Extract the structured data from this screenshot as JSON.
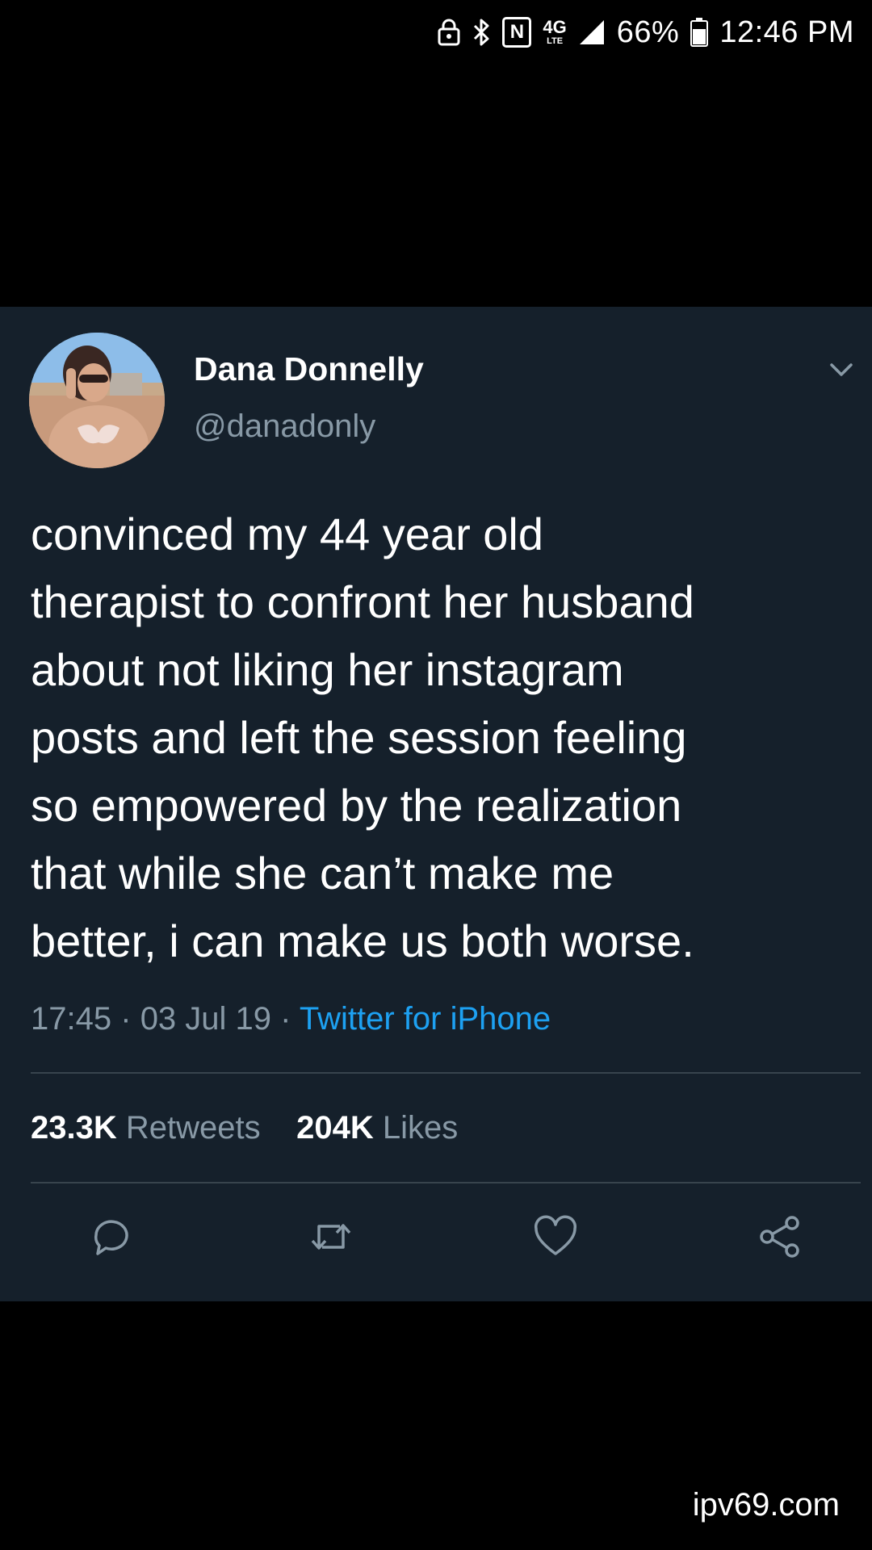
{
  "status_bar": {
    "network_label": "4G",
    "network_sub": "LTE",
    "battery": "66%",
    "time": "12:46 PM"
  },
  "tweet": {
    "display_name": "Dana Donnelly",
    "handle": "@danadonly",
    "text": "convinced my 44 year old\ntherapist to confront her husband\nabout not liking her instagram\nposts and left the session feeling\nso empowered by the realization\nthat while she can’t make me\nbetter, i can make us both worse.",
    "time": "17:45",
    "date": "03 Jul 19",
    "separator": "·",
    "source": "Twitter for iPhone",
    "retweets_count": "23.3K",
    "retweets_label": "Retweets",
    "likes_count": "204K",
    "likes_label": "Likes"
  },
  "watermark": "ipv69.com",
  "icons": [
    "lock-icon",
    "bluetooth-icon",
    "nfc-icon",
    "signal-icon",
    "battery-icon",
    "chevron-down-icon",
    "reply-icon",
    "retweet-icon",
    "like-icon",
    "share-icon"
  ],
  "colors": {
    "card_background": "#15202b",
    "accent": "#1da1f2",
    "secondary_text": "#8899a6",
    "divider": "#38444d"
  }
}
